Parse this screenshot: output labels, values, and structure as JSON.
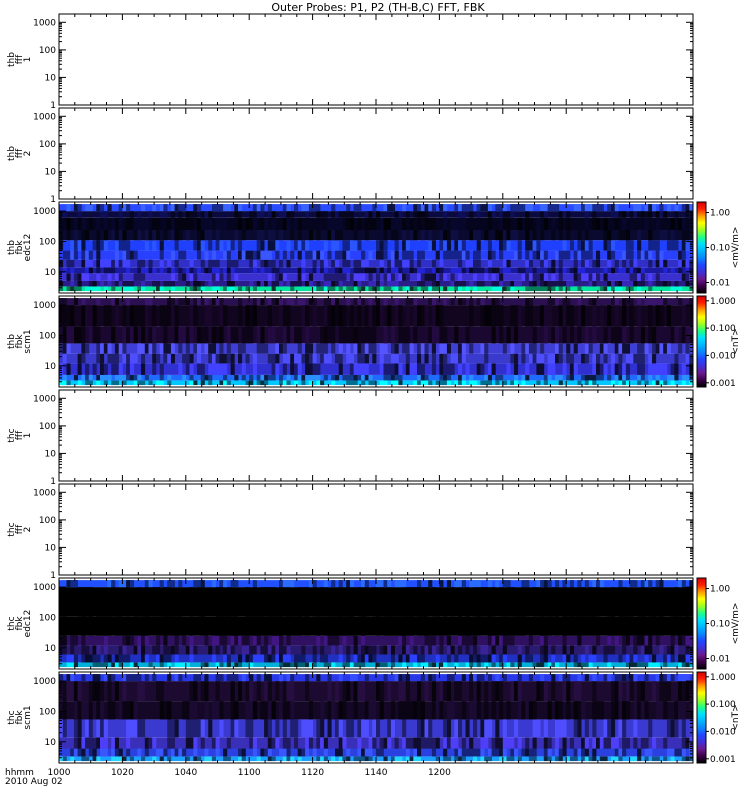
{
  "title": "Outer Probes: P1, P2 (TH-B,C) FFT, FBK",
  "footer": {
    "axis_label": "hhmm",
    "date": "2010 Aug 02"
  },
  "colors": {
    "ramp": [
      "#000000",
      "#3a0048",
      "#6a1890",
      "#3f2fd8",
      "#2047ff",
      "#0a86ff",
      "#00b7ff",
      "#00e0ff",
      "#20ff80",
      "#a0ff20",
      "#ffff00",
      "#ff9d00",
      "#ff2000",
      "#d40000"
    ]
  },
  "chart_data": [
    {
      "type": "heatmap",
      "ylabel": [
        "thb",
        "fff",
        "1"
      ],
      "yscale": "log",
      "ylim": [
        1,
        2000
      ],
      "yticks": [
        "1000",
        "100",
        "10",
        "1"
      ],
      "empty": true,
      "xlim": [
        1000,
        1200
      ]
    },
    {
      "type": "heatmap",
      "ylabel": [
        "thb",
        "fff",
        "2"
      ],
      "yscale": "log",
      "ylim": [
        1,
        2000
      ],
      "yticks": [
        "1000",
        "100",
        "10",
        "1"
      ],
      "empty": true,
      "xlim": [
        1000,
        1200
      ]
    },
    {
      "type": "heatmap",
      "ylabel": [
        "thb",
        "fbk",
        "edc12"
      ],
      "yscale": "log",
      "ylim": [
        2,
        2000
      ],
      "yticks": [
        "1000",
        "100",
        "10"
      ],
      "empty": false,
      "xlim": [
        1000,
        1200
      ],
      "colorbar": {
        "label": "<mV/m>",
        "ticks": [
          "1.00",
          "0.10",
          "0.01"
        ],
        "range": [
          0.005,
          2.0
        ]
      },
      "bands": [
        [
          2.3,
          3.3,
          "#00e8a0"
        ],
        [
          3.3,
          5,
          "#2a1d8a"
        ],
        [
          5,
          9,
          "#3a2fcf"
        ],
        [
          9,
          14,
          "#1a1aa0"
        ],
        [
          14,
          25,
          "#3030c8"
        ],
        [
          25,
          50,
          "#2a40ff"
        ],
        [
          50,
          110,
          "#2040ff"
        ],
        [
          110,
          240,
          "#0a0a30"
        ],
        [
          240,
          600,
          "#050520"
        ],
        [
          600,
          1000,
          "#0a0a40"
        ],
        [
          1000,
          1700,
          "#2a4aff"
        ]
      ]
    },
    {
      "type": "heatmap",
      "ylabel": [
        "thb",
        "fbk",
        "scm1"
      ],
      "yscale": "log",
      "ylim": [
        2,
        2000
      ],
      "yticks": [
        "1000",
        "100",
        "10"
      ],
      "empty": false,
      "xlim": [
        1000,
        1200
      ],
      "colorbar": {
        "label": "<nT>",
        "ticks": [
          "1.000",
          "0.100",
          "0.010",
          "0.001"
        ],
        "range": [
          0.0007,
          1.5
        ]
      },
      "bands": [
        [
          2.3,
          3.3,
          "#00c8ff"
        ],
        [
          3.3,
          5,
          "#1f6bff"
        ],
        [
          5,
          12,
          "#3030d0"
        ],
        [
          12,
          25,
          "#3a3acc"
        ],
        [
          25,
          55,
          "#3f3fd8"
        ],
        [
          55,
          200,
          "#1a0830"
        ],
        [
          200,
          1000,
          "#120520"
        ],
        [
          1000,
          1700,
          "#2a1050"
        ]
      ]
    },
    {
      "type": "heatmap",
      "ylabel": [
        "thc",
        "fff",
        "1"
      ],
      "yscale": "log",
      "ylim": [
        1,
        2000
      ],
      "yticks": [
        "1000",
        "100",
        "10",
        "1"
      ],
      "empty": true,
      "xlim": [
        1000,
        1200
      ]
    },
    {
      "type": "heatmap",
      "ylabel": [
        "thc",
        "fff",
        "2"
      ],
      "yscale": "log",
      "ylim": [
        1,
        2000
      ],
      "yticks": [
        "1000",
        "100",
        "10",
        "1"
      ],
      "empty": true,
      "xlim": [
        1000,
        1200
      ]
    },
    {
      "type": "heatmap",
      "ylabel": [
        "thc",
        "fbk",
        "edc12"
      ],
      "yscale": "log",
      "ylim": [
        2,
        2000
      ],
      "yticks": [
        "1000",
        "100",
        "10"
      ],
      "empty": false,
      "xlim": [
        1000,
        1200
      ],
      "colorbar": {
        "label": "<mV/m>",
        "ticks": [
          "1.00",
          "0.10",
          "0.01"
        ],
        "range": [
          0.005,
          2.0
        ]
      },
      "bands": [
        [
          2.3,
          3.3,
          "#00b0d8"
        ],
        [
          3.3,
          6,
          "#2030c0"
        ],
        [
          6,
          12,
          "#2a1a70"
        ],
        [
          12,
          25,
          "#301060"
        ],
        [
          25,
          110,
          "#000000"
        ],
        [
          110,
          1000,
          "#000000"
        ],
        [
          1000,
          1700,
          "#2050ff"
        ]
      ]
    },
    {
      "type": "heatmap",
      "ylabel": [
        "thc",
        "fbk",
        "scm1"
      ],
      "yscale": "log",
      "ylim": [
        2,
        2000
      ],
      "yticks": [
        "1000",
        "100",
        "10"
      ],
      "empty": false,
      "xlim": [
        1000,
        1200
      ],
      "colorbar": {
        "label": "<nT>",
        "ticks": [
          "1.000",
          "0.100",
          "0.010",
          "0.001"
        ],
        "range": [
          0.0007,
          1.5
        ]
      },
      "bands": [
        [
          2.3,
          3.3,
          "#1aa0ff"
        ],
        [
          3.3,
          6,
          "#2a40e0"
        ],
        [
          6,
          14,
          "#3a2fb8"
        ],
        [
          14,
          55,
          "#3a3ad0"
        ],
        [
          55,
          220,
          "#140826"
        ],
        [
          220,
          1000,
          "#1c0a30"
        ],
        [
          1000,
          1700,
          "#2838e8"
        ]
      ]
    }
  ],
  "xaxis": {
    "ticks": [
      "1000",
      "1020",
      "1040",
      "1100",
      "1120",
      "1140",
      "1200"
    ],
    "positions": [
      1000,
      1020,
      1040,
      1060,
      1080,
      1100,
      1120
    ]
  }
}
